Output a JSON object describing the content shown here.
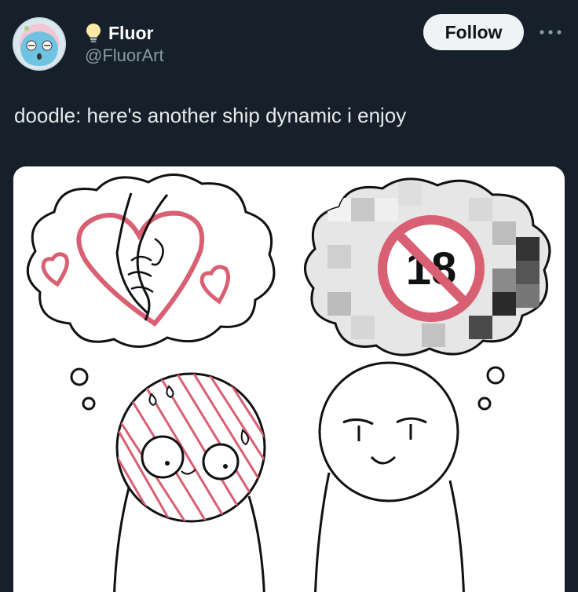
{
  "author": {
    "display_name": "Fluor",
    "handle": "@FluorArt",
    "avatar_icon": "jellyfish-avatar-icon",
    "badge_icon": "lightbulb-icon"
  },
  "actions": {
    "follow_label": "Follow",
    "more_icon": "more-dots-icon"
  },
  "tweet": {
    "text": "doodle: here's another ship dynamic i enjoy"
  },
  "media": {
    "censor_label": "18"
  },
  "colors": {
    "background": "#15202b",
    "text_primary": "#e7e9ea",
    "text_secondary": "#8b98a5",
    "follow_bg": "#eff3f4",
    "doodle_pink": "#d95f72"
  }
}
